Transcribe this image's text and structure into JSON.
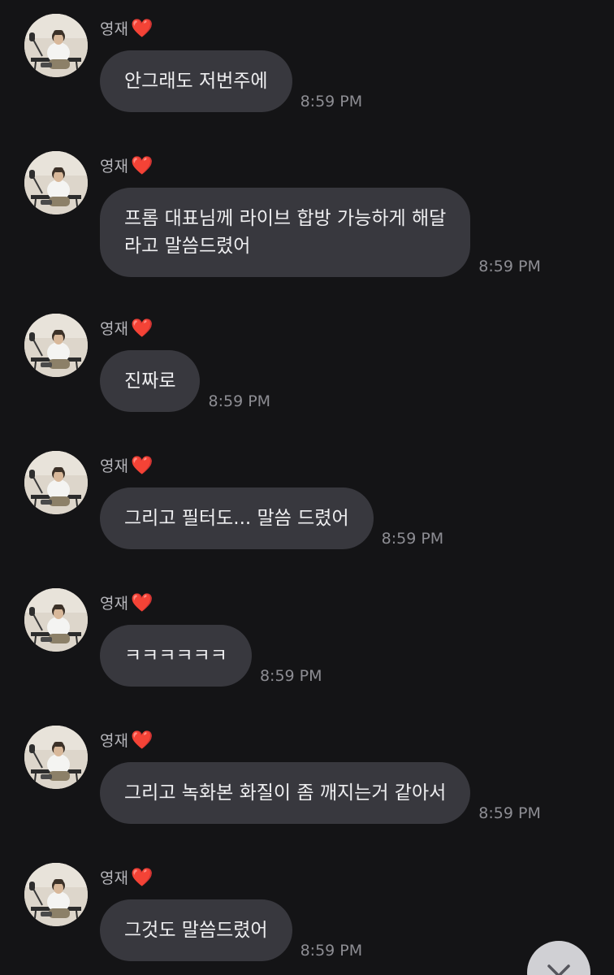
{
  "chat": {
    "messages": [
      {
        "sender": "영재",
        "heart": "❤️",
        "text": "안그래도 저번주에",
        "time": "8:59 PM"
      },
      {
        "sender": "영재",
        "heart": "❤️",
        "text": "프롬 대표님께 라이브 합방 가능하게 해달\n라고 말씀드렸어",
        "time": "8:59 PM"
      },
      {
        "sender": "영재",
        "heart": "❤️",
        "text": "진짜로",
        "time": "8:59 PM"
      },
      {
        "sender": "영재",
        "heart": "❤️",
        "text": "그리고 필터도... 말씀 드렸어",
        "time": "8:59 PM"
      },
      {
        "sender": "영재",
        "heart": "❤️",
        "text": "ㅋㅋㅋㅋㅋㅋ",
        "time": "8:59 PM"
      },
      {
        "sender": "영재",
        "heart": "❤️",
        "text": "그리고 녹화본 화질이 좀 깨지는거 같아서",
        "time": "8:59 PM"
      },
      {
        "sender": "영재",
        "heart": "❤️",
        "text": "그것도 말씀드렸어",
        "time": "8:59 PM"
      }
    ]
  },
  "icons": {
    "heart": "heart-icon",
    "scroll_down": "chevron-down-icon"
  },
  "colors": {
    "background": "#141416",
    "bubble": "#38383e",
    "message_text": "#eeeef0",
    "sender_text": "#b5b5ba",
    "time_text": "#8d8d93",
    "heart": "#e8323f",
    "scroll_button": "#d0d0d4"
  }
}
